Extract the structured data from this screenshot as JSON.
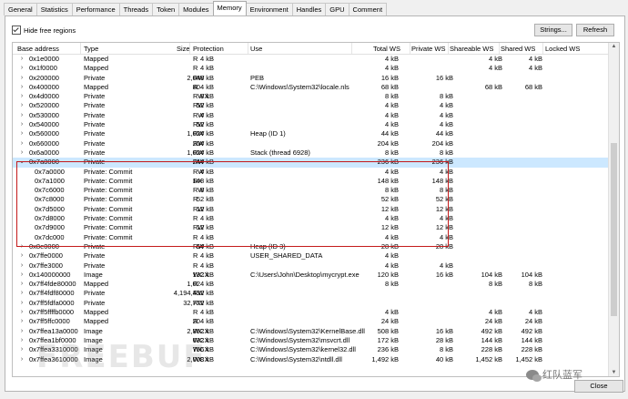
{
  "tabs": [
    "General",
    "Statistics",
    "Performance",
    "Threads",
    "Token",
    "Modules",
    "Memory",
    "Environment",
    "Handles",
    "GPU",
    "Comment"
  ],
  "active_tab": "Memory",
  "hide_free_label": "Hide free regions",
  "strings_button": "Strings...",
  "refresh_button": "Refresh",
  "close_button": "Close",
  "columns": {
    "addr": "Base address",
    "type": "Type",
    "size": "Size",
    "prot": "Protection",
    "use": "Use",
    "tws": "Total WS",
    "pws": "Private WS",
    "sws": "Shareable WS",
    "shws": "Shared WS",
    "lws": "Locked WS"
  },
  "rows": [
    {
      "chev": "›",
      "addr": "0x1e0000",
      "type": "Mapped",
      "size": "4 kB",
      "prot": "R",
      "use": "",
      "tws": "4 kB",
      "pws": "",
      "sws": "4 kB",
      "shws": "4 kB"
    },
    {
      "chev": "›",
      "addr": "0x1f0000",
      "type": "Mapped",
      "size": "4 kB",
      "prot": "R",
      "use": "",
      "tws": "4 kB",
      "pws": "",
      "sws": "4 kB",
      "shws": "4 kB"
    },
    {
      "chev": "›",
      "addr": "0x200000",
      "type": "Private",
      "size": "2,048 kB",
      "prot": "RW",
      "use": "PEB",
      "tws": "16 kB",
      "pws": "16 kB",
      "sws": "",
      "shws": ""
    },
    {
      "chev": "›",
      "addr": "0x400000",
      "type": "Mapped",
      "size": "804 kB",
      "prot": "R",
      "use": "C:\\Windows\\System32\\locale.nls",
      "tws": "68 kB",
      "pws": "",
      "sws": "68 kB",
      "shws": "68 kB"
    },
    {
      "chev": "›",
      "addr": "0x4d0000",
      "type": "Private",
      "size": "8 kB",
      "prot": "RWX",
      "use": "",
      "tws": "8 kB",
      "pws": "8 kB",
      "sws": "",
      "shws": ""
    },
    {
      "chev": "›",
      "addr": "0x520000",
      "type": "Private",
      "size": "52 kB",
      "prot": "RW",
      "use": "",
      "tws": "4 kB",
      "pws": "4 kB",
      "sws": "",
      "shws": ""
    },
    {
      "chev": "›",
      "addr": "0x530000",
      "type": "Private",
      "size": "4 kB",
      "prot": "RW",
      "use": "",
      "tws": "4 kB",
      "pws": "4 kB",
      "sws": "",
      "shws": ""
    },
    {
      "chev": "›",
      "addr": "0x540000",
      "type": "Private",
      "size": "52 kB",
      "prot": "RW",
      "use": "",
      "tws": "4 kB",
      "pws": "4 kB",
      "sws": "",
      "shws": ""
    },
    {
      "chev": "›",
      "addr": "0x560000",
      "type": "Private",
      "size": "1,024 kB",
      "prot": "RW",
      "use": "Heap (ID 1)",
      "tws": "44 kB",
      "pws": "44 kB",
      "sws": "",
      "shws": ""
    },
    {
      "chev": "›",
      "addr": "0x660000",
      "type": "Private",
      "size": "204 kB",
      "prot": "RW",
      "use": "",
      "tws": "204 kB",
      "pws": "204 kB",
      "sws": "",
      "shws": ""
    },
    {
      "chev": "›",
      "addr": "0x6a0000",
      "type": "Private",
      "size": "1,024 kB",
      "prot": "RW",
      "use": "Stack (thread 6928)",
      "tws": "8 kB",
      "pws": "8 kB",
      "sws": "",
      "shws": ""
    },
    {
      "chev": "⌄",
      "addr": "0x7a0000",
      "type": "Private",
      "size": "244 kB",
      "prot": "RW",
      "use": "",
      "tws": "236 kB",
      "pws": "236 kB",
      "sws": "",
      "shws": "",
      "sel": true
    },
    {
      "child": true,
      "addr": "0x7a0000",
      "type": "Private: Commit",
      "size": "4 kB",
      "prot": "RW",
      "use": "",
      "tws": "4 kB",
      "pws": "4 kB",
      "sws": "",
      "shws": ""
    },
    {
      "child": true,
      "addr": "0x7a1000",
      "type": "Private: Commit",
      "size": "148 kB",
      "prot": "RX",
      "use": "",
      "tws": "148 kB",
      "pws": "148 kB",
      "sws": "",
      "shws": ""
    },
    {
      "child": true,
      "addr": "0x7c6000",
      "type": "Private: Commit",
      "size": "8 kB",
      "prot": "RW",
      "use": "",
      "tws": "8 kB",
      "pws": "8 kB",
      "sws": "",
      "shws": ""
    },
    {
      "child": true,
      "addr": "0x7c8000",
      "type": "Private: Commit",
      "size": "52 kB",
      "prot": "R",
      "use": "",
      "tws": "52 kB",
      "pws": "52 kB",
      "sws": "",
      "shws": ""
    },
    {
      "child": true,
      "addr": "0x7d5000",
      "type": "Private: Commit",
      "size": "12 kB",
      "prot": "RW",
      "use": "",
      "tws": "12 kB",
      "pws": "12 kB",
      "sws": "",
      "shws": ""
    },
    {
      "child": true,
      "addr": "0x7d8000",
      "type": "Private: Commit",
      "size": "4 kB",
      "prot": "R",
      "use": "",
      "tws": "4 kB",
      "pws": "4 kB",
      "sws": "",
      "shws": ""
    },
    {
      "child": true,
      "addr": "0x7d9000",
      "type": "Private: Commit",
      "size": "12 kB",
      "prot": "RW",
      "use": "",
      "tws": "12 kB",
      "pws": "12 kB",
      "sws": "",
      "shws": ""
    },
    {
      "child": true,
      "addr": "0x7dc000",
      "type": "Private: Commit",
      "size": "4 kB",
      "prot": "R",
      "use": "",
      "tws": "4 kB",
      "pws": "4 kB",
      "sws": "",
      "shws": ""
    },
    {
      "chev": "›",
      "addr": "0x8e0000",
      "type": "Private",
      "size": "64 kB",
      "prot": "RW",
      "use": "Heap (ID 3)",
      "tws": "28 kB",
      "pws": "28 kB",
      "sws": "",
      "shws": ""
    },
    {
      "chev": "›",
      "addr": "0x7ffe0000",
      "type": "Private",
      "size": "4 kB",
      "prot": "R",
      "use": "USER_SHARED_DATA",
      "tws": "4 kB",
      "pws": "",
      "sws": "",
      "shws": ""
    },
    {
      "chev": "›",
      "addr": "0x7ffe3000",
      "type": "Private",
      "size": "4 kB",
      "prot": "R",
      "use": "",
      "tws": "4 kB",
      "pws": "4 kB",
      "sws": "",
      "shws": ""
    },
    {
      "chev": "›",
      "addr": "0x140000000",
      "type": "Image",
      "size": "132 kB",
      "prot": "WCX",
      "use": "C:\\Users\\John\\Desktop\\mycrypt.exe",
      "tws": "120 kB",
      "pws": "16 kB",
      "sws": "104 kB",
      "shws": "104 kB"
    },
    {
      "chev": "›",
      "addr": "0x7ff4fde80000",
      "type": "Mapped",
      "size": "1,024 kB",
      "prot": "R",
      "use": "",
      "tws": "8 kB",
      "pws": "",
      "sws": "8 kB",
      "shws": "8 kB"
    },
    {
      "chev": "›",
      "addr": "0x7ff4fdf80000",
      "type": "Private",
      "size": "4,194,432 kB",
      "prot": "RW",
      "use": "",
      "tws": "",
      "pws": "",
      "sws": "",
      "shws": ""
    },
    {
      "chev": "›",
      "addr": "0x7ff5fdfa0000",
      "type": "Private",
      "size": "32,772 kB",
      "prot": "RW",
      "use": "",
      "tws": "",
      "pws": "",
      "sws": "",
      "shws": ""
    },
    {
      "chev": "›",
      "addr": "0x7ff5ffffb0000",
      "type": "Mapped",
      "size": "4 kB",
      "prot": "R",
      "use": "",
      "tws": "4 kB",
      "pws": "",
      "sws": "4 kB",
      "shws": "4 kB"
    },
    {
      "chev": "›",
      "addr": "0x7ff5ffc0000",
      "type": "Mapped",
      "size": "204 kB",
      "prot": "R",
      "use": "",
      "tws": "24 kB",
      "pws": "",
      "sws": "24 kB",
      "shws": "24 kB"
    },
    {
      "chev": "›",
      "addr": "0x7ffea13a0000",
      "type": "Image",
      "size": "2,852 kB",
      "prot": "WCX",
      "use": "C:\\Windows\\System32\\KernelBase.dll",
      "tws": "508 kB",
      "pws": "16 kB",
      "sws": "492 kB",
      "shws": "492 kB"
    },
    {
      "chev": "›",
      "addr": "0x7ffea1bf0000",
      "type": "Image",
      "size": "632 kB",
      "prot": "WCX",
      "use": "C:\\Windows\\System32\\msvcrt.dll",
      "tws": "172 kB",
      "pws": "28 kB",
      "sws": "144 kB",
      "shws": "144 kB"
    },
    {
      "chev": "›",
      "addr": "0x7ffea3310000",
      "type": "Image",
      "size": "756 kB",
      "prot": "WCX",
      "use": "C:\\Windows\\System32\\kernel32.dll",
      "tws": "236 kB",
      "pws": "8 kB",
      "sws": "228 kB",
      "shws": "228 kB"
    },
    {
      "chev": "›",
      "addr": "0x7ffea3610000",
      "type": "Image",
      "size": "2,008 kB",
      "prot": "WCX",
      "use": "C:\\Windows\\System32\\ntdll.dll",
      "tws": "1,492 kB",
      "pws": "40 kB",
      "sws": "1,452 kB",
      "shws": "1,452 kB"
    }
  ],
  "watermark": "FREEBUF",
  "wechat_label": "红队蓝军"
}
